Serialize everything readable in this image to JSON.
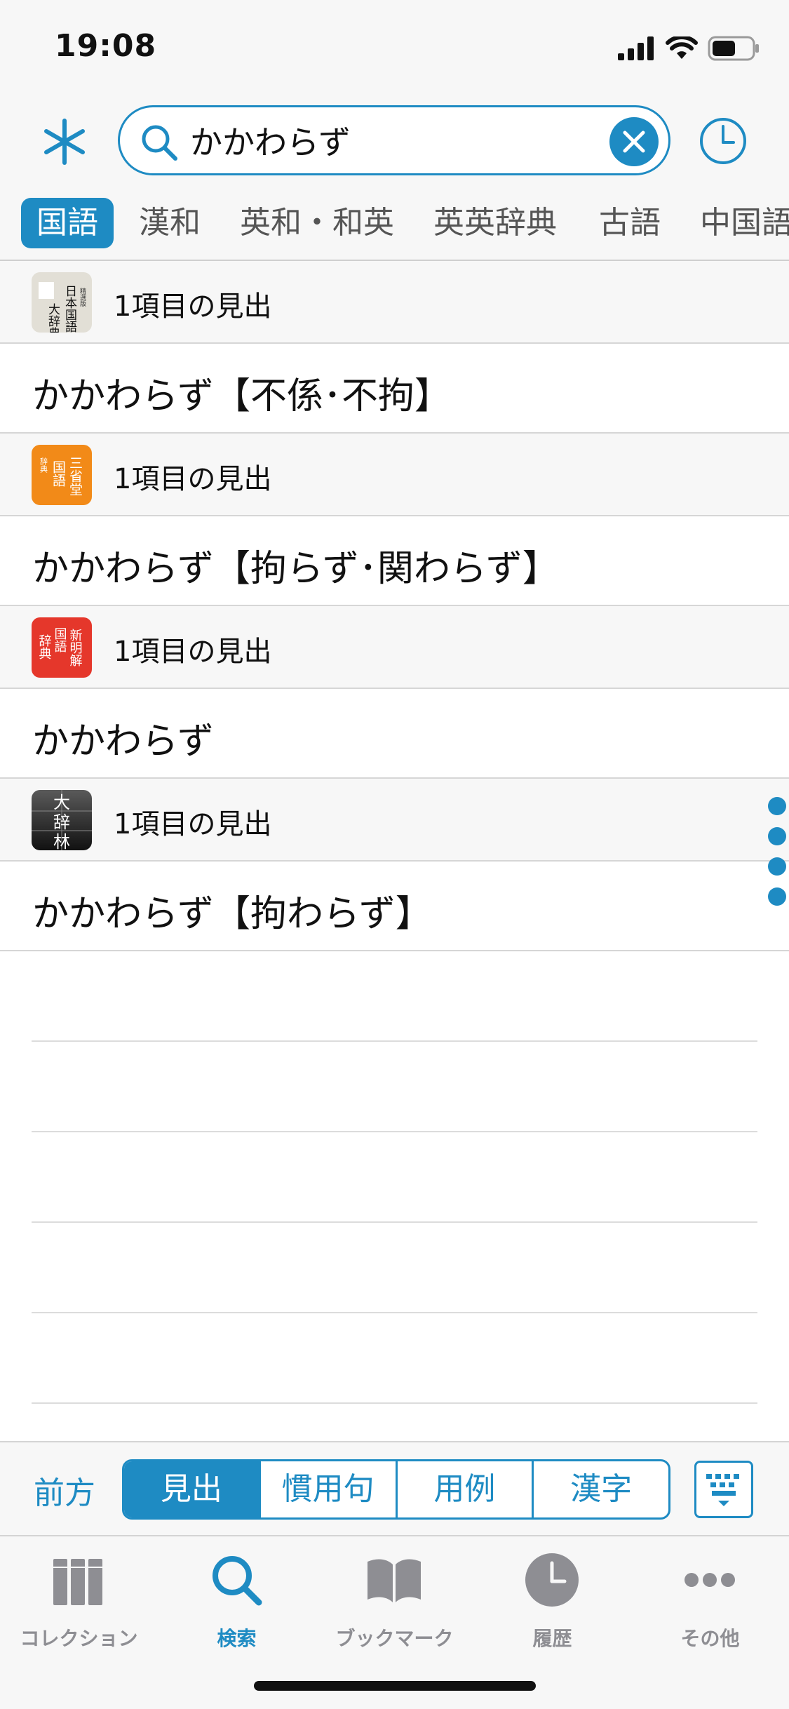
{
  "status_bar": {
    "time": "19:08"
  },
  "search": {
    "query": "かかわらず"
  },
  "categories": [
    {
      "label": "国語",
      "active": true
    },
    {
      "label": "漢和",
      "active": false
    },
    {
      "label": "英和・和英",
      "active": false
    },
    {
      "label": "英英辞典",
      "active": false
    },
    {
      "label": "古語",
      "active": false
    },
    {
      "label": "中国語",
      "active": false
    }
  ],
  "results": [
    {
      "dict_icon": "seisenban-nihon-kokugo-daijiten-icon",
      "dict_icon_text": "精選版 日本国語大辞典",
      "count_label": "1項目の見出",
      "entry": "かかわらず【不係･不拘】"
    },
    {
      "dict_icon": "sanseido-kokugo-jiten-icon",
      "dict_icon_text": "三省堂国語辞典",
      "count_label": "1項目の見出",
      "entry": "かかわらず【拘らず･関わらず】"
    },
    {
      "dict_icon": "shinmeikai-kokugo-jiten-icon",
      "dict_icon_text": "新明解国語辞典",
      "count_label": "1項目の見出",
      "entry": "かかわらず"
    },
    {
      "dict_icon": "daijirin-icon",
      "dict_icon_text": "大辞林",
      "count_label": "1項目の見出",
      "entry": "かかわらず【拘わらず】"
    }
  ],
  "mode_bar": {
    "prev_label": "前方",
    "segments": [
      {
        "label": "見出",
        "active": true
      },
      {
        "label": "慣用句",
        "active": false
      },
      {
        "label": "用例",
        "active": false
      },
      {
        "label": "漢字",
        "active": false
      }
    ]
  },
  "tab_bar": {
    "items": [
      {
        "label": "コレクション",
        "icon": "books-icon",
        "active": false
      },
      {
        "label": "検索",
        "icon": "search-icon",
        "active": true
      },
      {
        "label": "ブックマーク",
        "icon": "open-book-icon",
        "active": false
      },
      {
        "label": "履歴",
        "icon": "clock-icon",
        "active": false
      },
      {
        "label": "その他",
        "icon": "more-icon",
        "active": false
      }
    ]
  },
  "colors": {
    "accent": "#1e8bc3",
    "background": "#f7f7f7",
    "inactive": "#8e8e93"
  }
}
